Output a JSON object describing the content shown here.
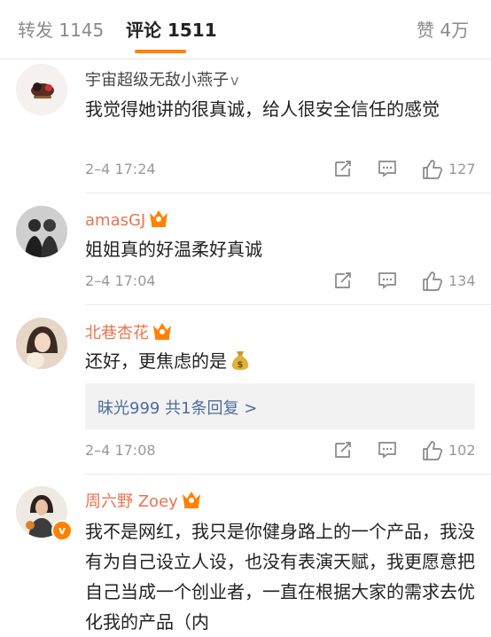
{
  "tabs": [
    {
      "label": "转发",
      "count": "1145"
    },
    {
      "label": "评论",
      "count": "1511"
    },
    {
      "label": "赞",
      "count": "4万"
    }
  ],
  "colors": {
    "accent": "#ff8200",
    "username_vip": "#eb7350",
    "link": "#4b6e9c"
  },
  "comments": [
    {
      "username": "宇宙超级无敌小燕子",
      "badge": "v",
      "text": "我觉得她讲的很真诚，给人很安全信任的感觉",
      "time": "2–4 17:24",
      "likes": "127"
    },
    {
      "username": "amasGJ",
      "text": "姐姐真的好温柔好真诚",
      "time": "2–4 17:04",
      "likes": "134"
    },
    {
      "username": "北巷杏花",
      "text": "还好，更焦虑的是",
      "emoji": "money-bag-icon",
      "reply_link": "昧光999  共1条回复 >",
      "time": "2–4 17:08",
      "likes": "102"
    },
    {
      "username": "周六野 Zoey",
      "text": "我不是网红，我只是你健身路上的一个产品，我没有为自己设立人设，也没有表演天赋，我更愿意把自己当成一个创业者，一直在根据大家的需求去优化我的产品（内",
      "avatar_badge": "v"
    }
  ]
}
